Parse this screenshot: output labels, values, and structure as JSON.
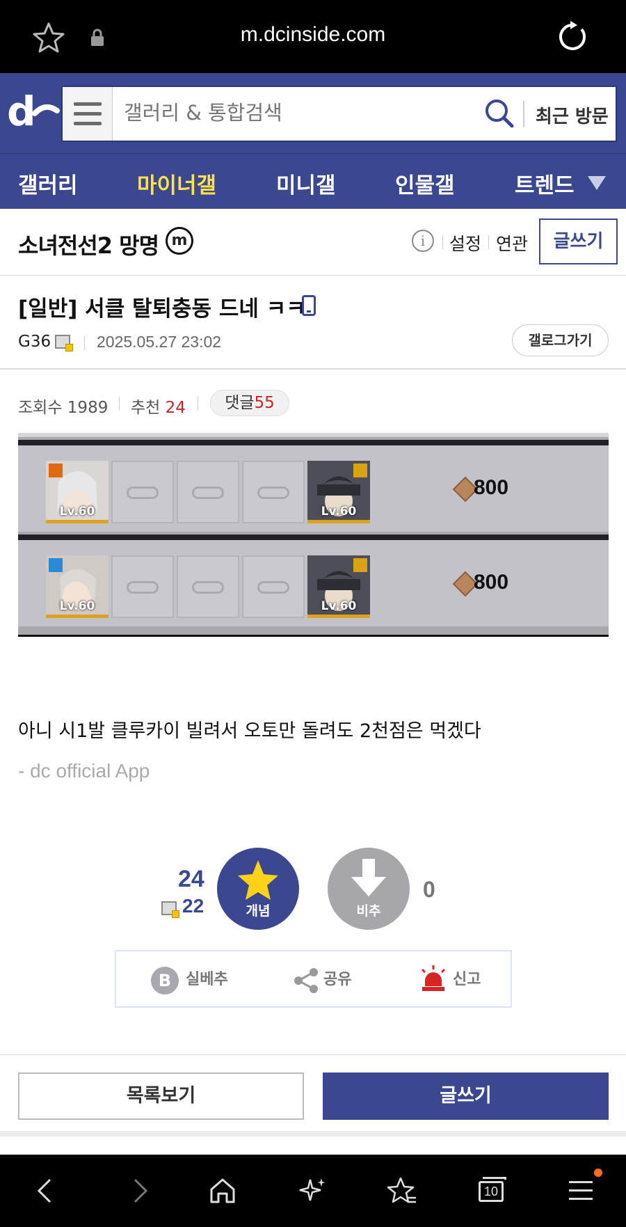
{
  "browser": {
    "url": "m.dcinside.com",
    "tabs_count": "10"
  },
  "header": {
    "search_placeholder": "갤러리 & 통합검색",
    "recent_label": "최근 방문"
  },
  "nav": {
    "tabs": [
      {
        "label": "갤러리",
        "active": false
      },
      {
        "label": "마이너갤",
        "active": true
      },
      {
        "label": "미니갤",
        "active": false
      },
      {
        "label": "인물갤",
        "active": false
      },
      {
        "label": "트렌드",
        "active": false
      }
    ]
  },
  "gallery": {
    "title": "소녀전선2 망명",
    "badge": "m",
    "settings_label": "설정",
    "related_label": "연관",
    "write_label": "글쓰기"
  },
  "post": {
    "title": "[일반] 서클 탈퇴충동 드네 ㅋㅋ",
    "author": "G36",
    "date": "2025.05.27 23:02",
    "gallog_label": "갤로그가기",
    "views_label": "조회수",
    "views": "1989",
    "recommend_label": "추천",
    "recommend": "24",
    "comments_label": "댓글",
    "comments": "55",
    "body": "아니 시1발 클루카이 빌려서 오토만 돌려도 2천점은 먹겠다",
    "signature": "- dc official App"
  },
  "screenshot": {
    "rows": [
      {
        "left_level": "Lv.60",
        "right_level": "Lv.60",
        "cost": "800"
      },
      {
        "left_level": "Lv.60",
        "right_level": "Lv.60",
        "cost": "800"
      }
    ]
  },
  "recommend": {
    "up_total": "24",
    "up_fixed": "22",
    "up_label": "개념",
    "down_label": "비추",
    "down_count": "0"
  },
  "actions": {
    "best": "실베추",
    "share": "공유",
    "report": "신고"
  },
  "bottom": {
    "list_label": "목록보기",
    "write_label": "글쓰기"
  },
  "colors": {
    "brand": "#3b4890",
    "active_tab": "#ffe24a",
    "red": "#c6232a"
  }
}
